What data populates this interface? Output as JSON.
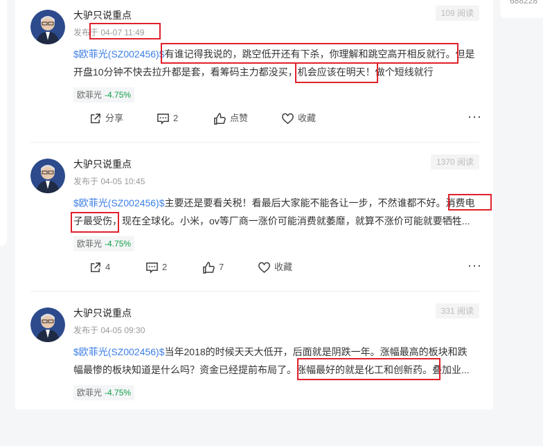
{
  "right_card_text": "688228",
  "colors": {
    "link": "#3b7ee6",
    "pct_down": "#10a14a",
    "highlight": "#e0202a"
  },
  "posts": [
    {
      "author": "大驴只说重点",
      "time": "发布于 04-07 11:49",
      "reads": "109 阅读",
      "line1": "$欧菲光(SZ002456)$有谁记得我说的，跳空低开还有下杀，你理解和跳空高开相反就行。但是",
      "line2": "开盘10分钟不快去拉升都是套，看筹码主力都没买，机会应该在明天！做个短线就行",
      "stock_name": "欧菲光",
      "stock_pct": "-4.75%",
      "share": "分享",
      "comments": "2",
      "like": "点赞",
      "fav": "收藏"
    },
    {
      "author": "大驴只说重点",
      "time": "发布于 04-05 10:45",
      "reads": "1370 阅读",
      "line1": "$欧菲光(SZ002456)$主要还是要看关税！看最后大家能不能各让一步，不然谁都不好。消费电",
      "line2": "子最受伤，现在全球化。小米，ov等厂商一涨价可能消费就萎靡，就算不涨价可能就要牺牲...",
      "stock_name": "欧菲光",
      "stock_pct": "-4.75%",
      "share": "4",
      "comments": "2",
      "like": "7",
      "fav": "收藏"
    },
    {
      "author": "大驴只说重点",
      "time": "发布于 04-05 09:30",
      "reads": "331 阅读",
      "line1": "$欧菲光(SZ002456)$当年2018的时候天天大低开，后面就是阴跌一年。涨幅最高的板块和跌",
      "line2": "幅最惨的板块知道是什么吗？资金已经提前布局了。涨幅最好的就是化工和创新药。叠加业...",
      "stock_name": "欧菲光",
      "stock_pct": "-4.75%"
    }
  ]
}
